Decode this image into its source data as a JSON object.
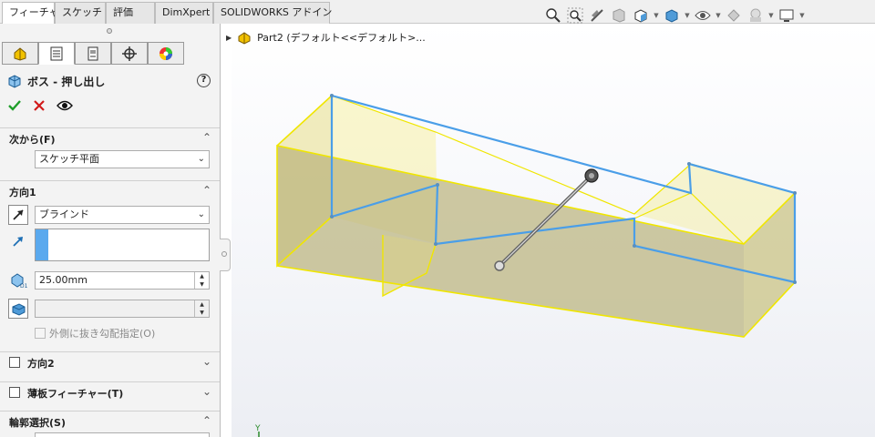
{
  "tabs": [
    {
      "label": "フィーチャー",
      "active": true
    },
    {
      "label": "スケッチ",
      "active": false
    },
    {
      "label": "評価",
      "active": false
    },
    {
      "label": "DimXpert",
      "active": false
    },
    {
      "label": "SOLIDWORKS アドイン",
      "active": false
    }
  ],
  "manager_tabs": [
    "feature-manager-icon",
    "property-manager-icon",
    "configuration-manager-icon",
    "dimxpert-manager-icon",
    "display-manager-icon"
  ],
  "feature": {
    "title": "ボス - 押し出し",
    "help": "?"
  },
  "actions": [
    "ok-check-icon",
    "cancel-x-icon",
    "preview-eye-icon"
  ],
  "from_section": {
    "label": "次から(F)",
    "value": "スケッチ平面"
  },
  "direction1": {
    "label": "方向1",
    "end_condition": "ブラインド",
    "depth": "25.00mm",
    "draft_label": "外側に抜き勾配指定(O)"
  },
  "direction2": {
    "label": "方向2"
  },
  "thin_feature": {
    "label": "薄板フィーチャー(T)"
  },
  "contours": {
    "label": "輪郭選択(S)"
  },
  "tree": {
    "part": "Part2 (デフォルト<<デフォルト>..."
  },
  "triad": {
    "y": "Y"
  },
  "colors": {
    "edge_highlight": "#f0e600",
    "sketch_blue": "#4a9ee8",
    "face_fill": "#c9c27a",
    "accent_green": "#1f9e2a",
    "accent_red": "#d11a1a"
  }
}
